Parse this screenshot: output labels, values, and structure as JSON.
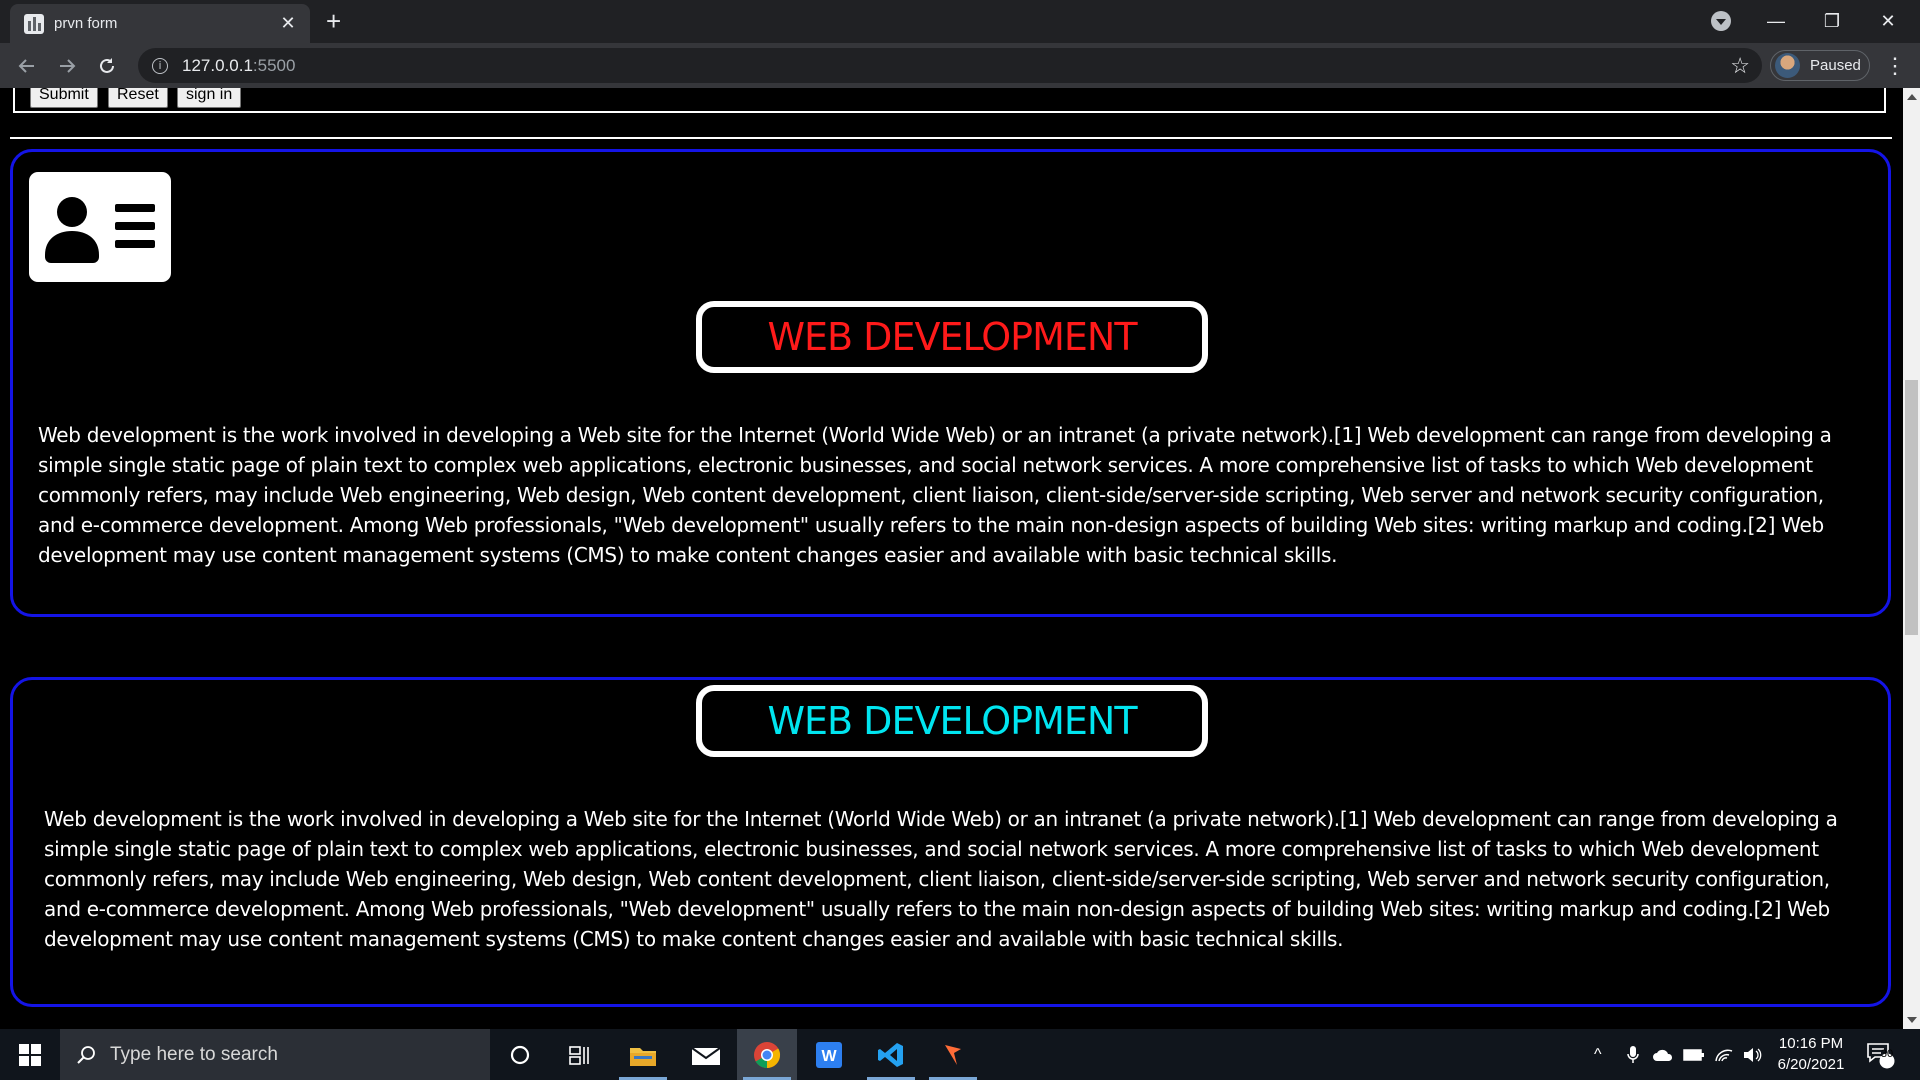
{
  "browser": {
    "tab_title": "prvn form",
    "tab_close": "✕",
    "new_tab": "+",
    "url_host": "127.0.0.1",
    "url_port": ":5500",
    "profile_label": "Paused",
    "win_minimize": "—",
    "win_restore": "❐",
    "win_close": "✕"
  },
  "form": {
    "buttons": [
      "Submit",
      "Reset",
      "sign in"
    ]
  },
  "sections": [
    {
      "heading": "WEB DEVELOPMENT",
      "heading_color": "#ff1a1a",
      "paragraph": "Web development is the work involved in developing a Web site for the Internet (World Wide Web) or an intranet (a private network).[1] Web development can range from developing a simple single static page of plain text to complex web applications, electronic businesses, and social network services. A more comprehensive list of tasks to which Web development commonly refers, may include Web engineering, Web design, Web content development, client liaison, client-side/server-side scripting, Web server and network security configuration, and e-commerce development. Among Web professionals, \"Web development\" usually refers to the main non-design aspects of building Web sites: writing markup and coding.[2] Web development may use content management systems (CMS) to make content changes easier and available with basic technical skills."
    },
    {
      "heading": "WEB DEVELOPMENT",
      "heading_color": "#00e5f0",
      "paragraph": "Web development is the work involved in developing a Web site for the Internet (World Wide Web) or an intranet (a private network).[1] Web development can range from developing a simple single static page of plain text to complex web applications, electronic businesses, and social network services. A more comprehensive list of tasks to which Web development commonly refers, may include Web engineering, Web design, Web content development, client liaison, client-side/server-side scripting, Web server and network security configuration, and e-commerce development. Among Web professionals, \"Web development\" usually refers to the main non-design aspects of building Web sites: writing markup and coding.[2] Web development may use content management systems (CMS) to make content changes easier and available with basic technical skills."
    }
  ],
  "taskbar": {
    "search_placeholder": "Type here to search",
    "time": "10:16 PM",
    "date": "6/20/2021",
    "notification_count": "30",
    "apps": [
      "cortana-icon",
      "task-view-icon",
      "file-explorer-icon",
      "mail-icon",
      "chrome-icon",
      "writer-icon",
      "vscode-icon",
      "postman-icon"
    ]
  },
  "colors": {
    "section_border": "#1414e6",
    "page_background": "#000000"
  }
}
